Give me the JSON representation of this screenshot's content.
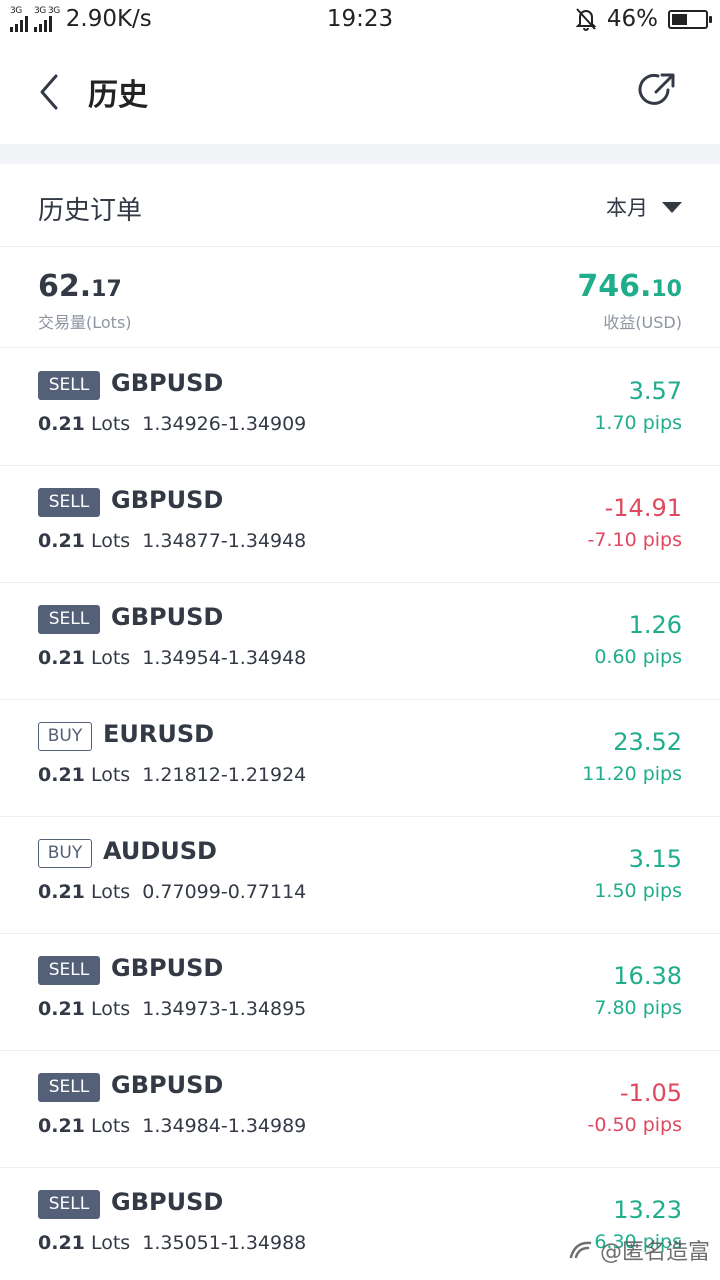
{
  "status_bar": {
    "network_1": "3G",
    "network_2": "3G 3G",
    "speed": "2.90K/s",
    "time": "19:23",
    "battery": "46%",
    "battery_level": 0.46
  },
  "header": {
    "title": "历史"
  },
  "section": {
    "title": "历史订单",
    "filter": "本月"
  },
  "summary": {
    "volume_int": "62.",
    "volume_dec": "17",
    "volume_label": "交易量(Lots)",
    "profit_int": "746.",
    "profit_dec": "10",
    "profit_label": "收益(USD)"
  },
  "orders": [
    {
      "side": "SELL",
      "pair": "GBPUSD",
      "lots": "0.21",
      "lots_unit": "Lots",
      "prices": "1.34926-1.34909",
      "profit": "3.57",
      "pips": "1.70 pips",
      "positive": true
    },
    {
      "side": "SELL",
      "pair": "GBPUSD",
      "lots": "0.21",
      "lots_unit": "Lots",
      "prices": "1.34877-1.34948",
      "profit": "-14.91",
      "pips": "-7.10 pips",
      "positive": false
    },
    {
      "side": "SELL",
      "pair": "GBPUSD",
      "lots": "0.21",
      "lots_unit": "Lots",
      "prices": "1.34954-1.34948",
      "profit": "1.26",
      "pips": "0.60 pips",
      "positive": true
    },
    {
      "side": "BUY",
      "pair": "EURUSD",
      "lots": "0.21",
      "lots_unit": "Lots",
      "prices": "1.21812-1.21924",
      "profit": "23.52",
      "pips": "11.20 pips",
      "positive": true
    },
    {
      "side": "BUY",
      "pair": "AUDUSD",
      "lots": "0.21",
      "lots_unit": "Lots",
      "prices": "0.77099-0.77114",
      "profit": "3.15",
      "pips": "1.50 pips",
      "positive": true
    },
    {
      "side": "SELL",
      "pair": "GBPUSD",
      "lots": "0.21",
      "lots_unit": "Lots",
      "prices": "1.34973-1.34895",
      "profit": "16.38",
      "pips": "7.80 pips",
      "positive": true
    },
    {
      "side": "SELL",
      "pair": "GBPUSD",
      "lots": "0.21",
      "lots_unit": "Lots",
      "prices": "1.34984-1.34989",
      "profit": "-1.05",
      "pips": "-0.50 pips",
      "positive": false
    },
    {
      "side": "SELL",
      "pair": "GBPUSD",
      "lots": "0.21",
      "lots_unit": "Lots",
      "prices": "1.35051-1.34988",
      "profit": "13.23",
      "pips": "6.30 pips",
      "positive": true
    }
  ],
  "watermark": "@匿名造富",
  "colors": {
    "positive": "#1fad8c",
    "negative": "#e0485d",
    "sell_badge": "#546078"
  }
}
